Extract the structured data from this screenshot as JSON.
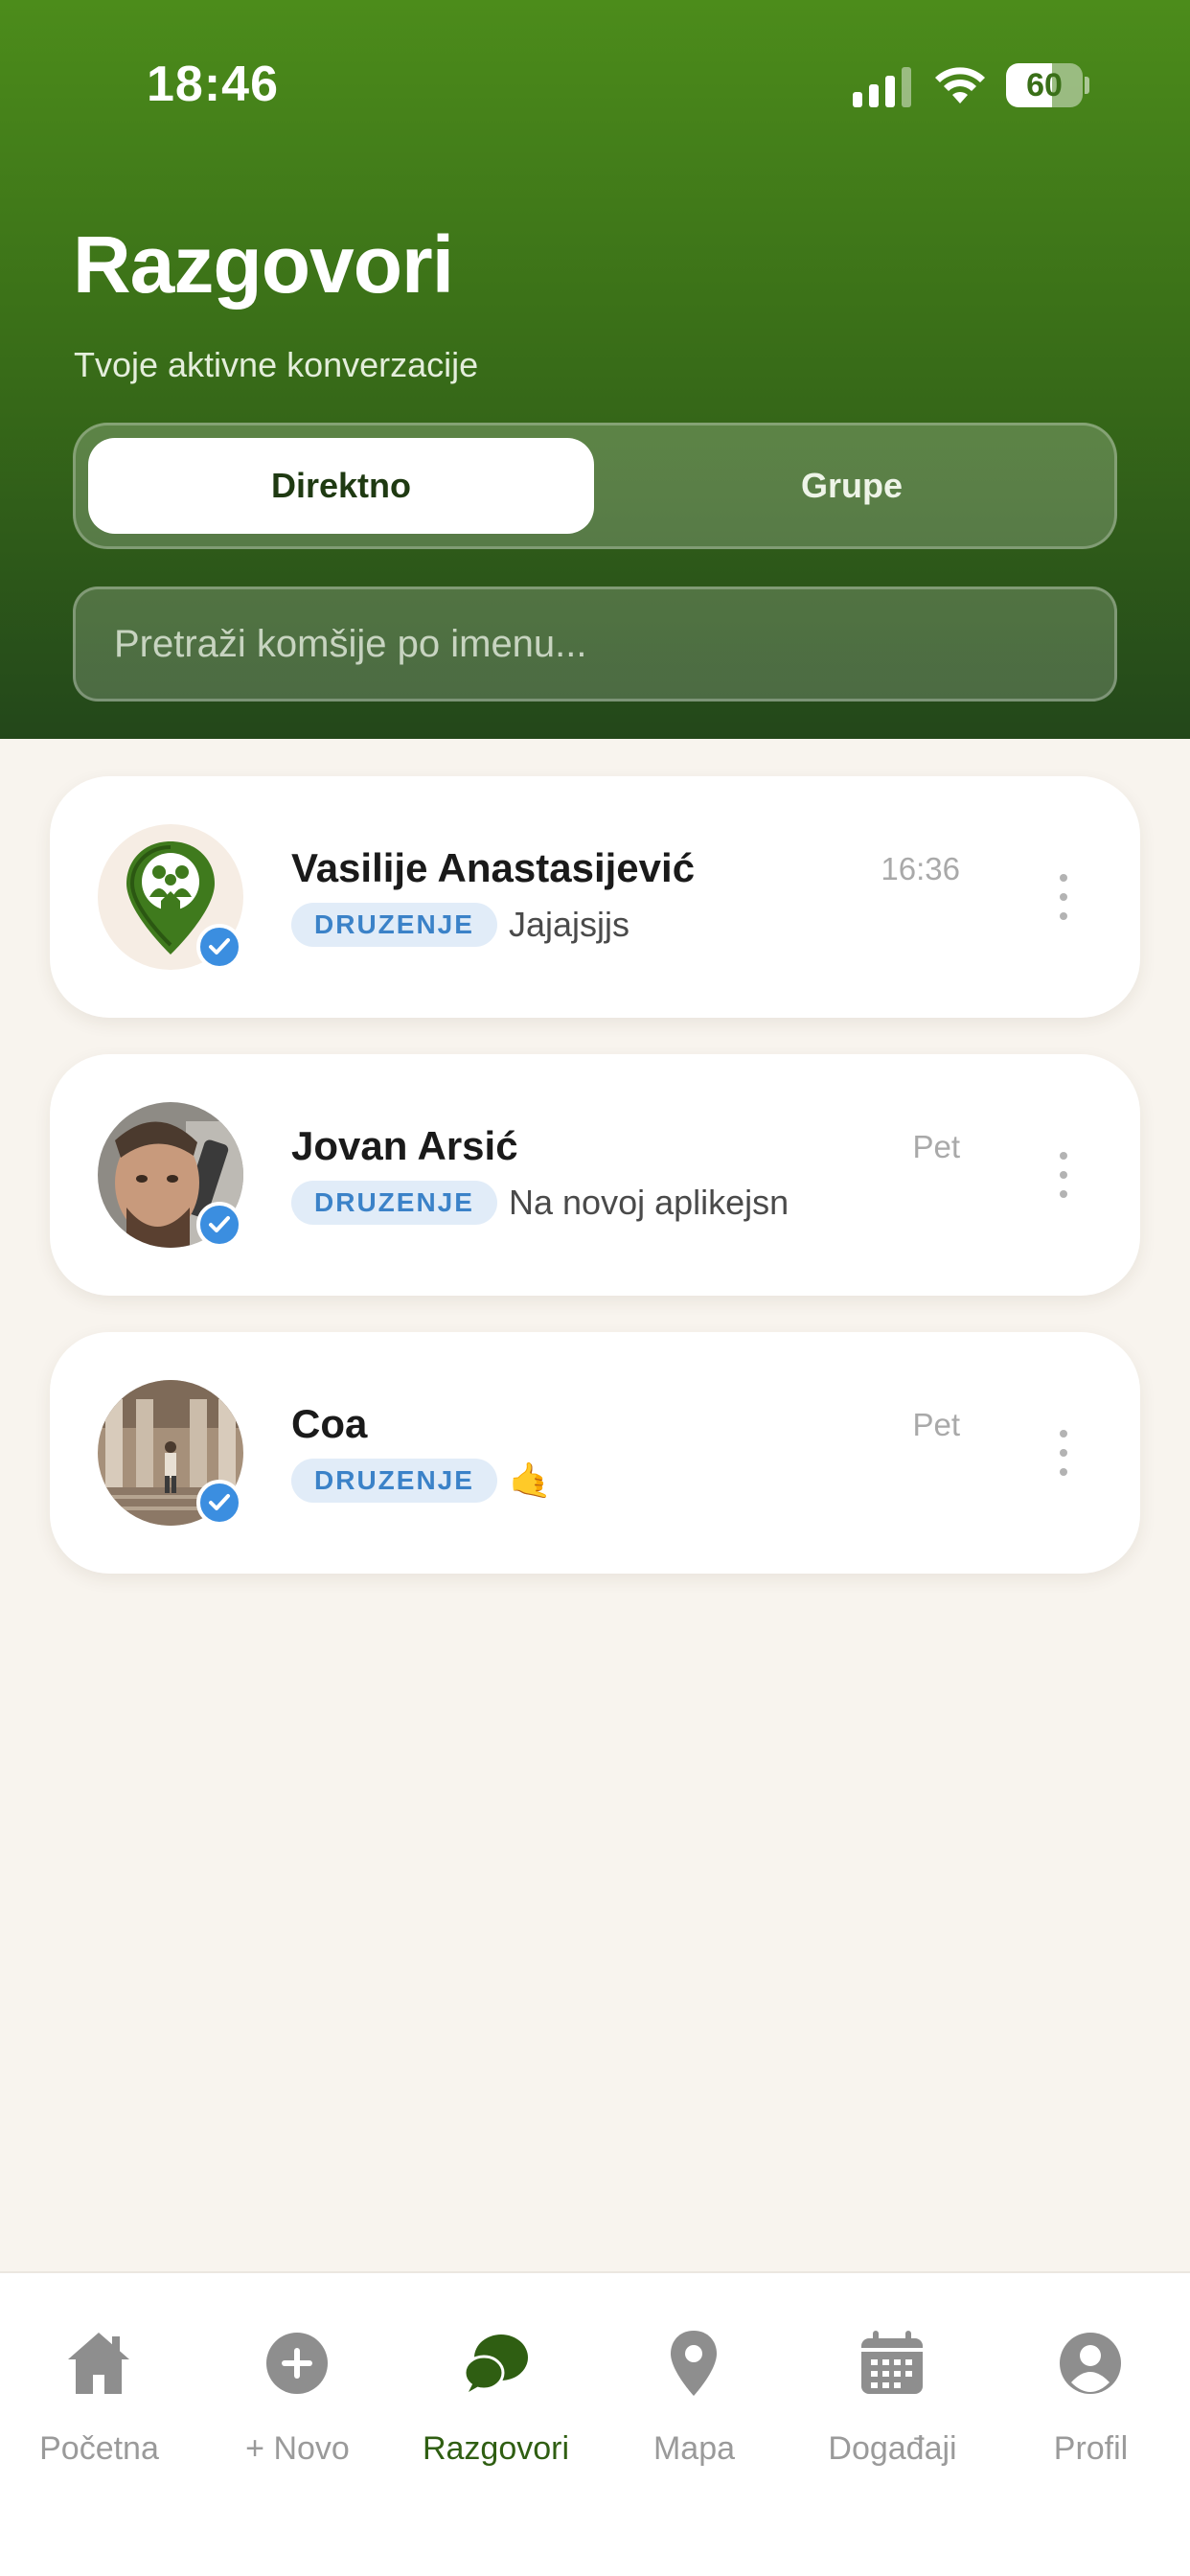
{
  "status_bar": {
    "time": "18:46",
    "battery": "60",
    "battery_level": 0.6
  },
  "header": {
    "title": "Razgovori",
    "subtitle": "Tvoje aktivne konverzacije",
    "tabs": [
      {
        "label": "Direktno",
        "active": true
      },
      {
        "label": "Grupe",
        "active": false
      }
    ],
    "search": {
      "placeholder": "Pretraži komšije po imenu...",
      "value": ""
    }
  },
  "conversations": [
    {
      "name": "Vasilije Anastasijević",
      "time": "16:36",
      "badge": "DRUZENJE",
      "message": "Jajajsjjs",
      "avatar": "app-logo-avatar",
      "verified": true
    },
    {
      "name": "Jovan Arsić",
      "time": "Pet",
      "badge": "DRUZENJE",
      "message": "Na novoj aplikejsn",
      "avatar": "photo-avatar",
      "verified": true
    },
    {
      "name": "Coa",
      "time": "Pet",
      "badge": "DRUZENJE",
      "message": "🤙",
      "avatar": "photo-avatar",
      "verified": true
    }
  ],
  "tabbar": {
    "items": [
      {
        "label": "Početna",
        "icon": "home-icon",
        "active": false
      },
      {
        "label": "+ Novo",
        "icon": "plus-circle-icon",
        "active": false
      },
      {
        "label": "Razgovori",
        "icon": "chat-bubbles-icon",
        "active": true
      },
      {
        "label": "Mapa",
        "icon": "map-pin-icon",
        "active": false
      },
      {
        "label": "Događaji",
        "icon": "calendar-icon",
        "active": false
      },
      {
        "label": "Profil",
        "icon": "user-circle-icon",
        "active": false
      }
    ]
  },
  "colors": {
    "brand_green": "#3a6f18",
    "active_tab": "#2f5e12",
    "badge_text": "#3b82c8",
    "badge_bg": "#e1ecf8",
    "verified": "#3b8ee0",
    "page_bg": "#f8f4ee"
  }
}
